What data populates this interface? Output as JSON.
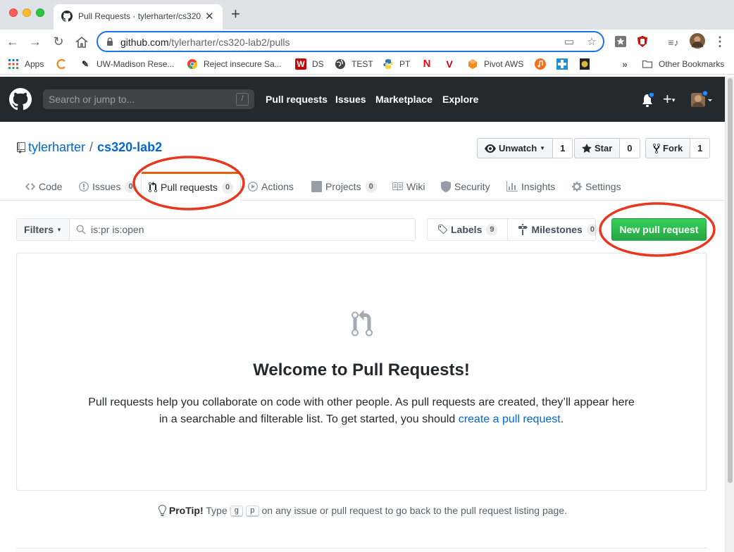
{
  "browser": {
    "tab_title": "Pull Requests · tylerharter/cs320",
    "new_tab": "+",
    "url_domain": "github.com",
    "url_path": "/tylerharter/cs320-lab2/pulls",
    "bookmarks": [
      {
        "label": "Apps",
        "icon": "apps-grid-icon"
      },
      {
        "label": "",
        "icon": "orange-c-icon"
      },
      {
        "label": "UW-Madison Rese...",
        "icon": "wand-icon"
      },
      {
        "label": "Reject insecure Sa...",
        "icon": "chrome-icon"
      },
      {
        "label": "DS",
        "icon": "w-icon"
      },
      {
        "label": "TEST",
        "icon": "globe-icon"
      },
      {
        "label": "PT",
        "icon": "python-icon"
      },
      {
        "label": "",
        "icon": "netflix-icon"
      },
      {
        "label": "",
        "icon": "v-icon"
      },
      {
        "label": "Pivot AWS",
        "icon": "hexagon-icon"
      }
    ],
    "overflow": "»",
    "other_bookmarks": "Other Bookmarks"
  },
  "gh_header": {
    "search_placeholder": "Search or jump to...",
    "search_key": "/",
    "nav": [
      "Pull requests",
      "Issues",
      "Marketplace",
      "Explore"
    ]
  },
  "repo": {
    "owner": "tylerharter",
    "separator": "/",
    "name": "cs320-lab2",
    "unwatch_label": "Unwatch",
    "unwatch_count": "1",
    "star_label": "Star",
    "star_count": "0",
    "fork_label": "Fork",
    "fork_count": "1"
  },
  "tabs": [
    {
      "label": "Code",
      "count": null
    },
    {
      "label": "Issues",
      "count": "0"
    },
    {
      "label": "Pull requests",
      "count": "0"
    },
    {
      "label": "Actions",
      "count": null
    },
    {
      "label": "Projects",
      "count": "0"
    },
    {
      "label": "Wiki",
      "count": null
    },
    {
      "label": "Security",
      "count": null
    },
    {
      "label": "Insights",
      "count": null
    },
    {
      "label": "Settings",
      "count": null
    }
  ],
  "subnav": {
    "filters_label": "Filters",
    "search_value": "is:pr is:open",
    "labels_label": "Labels",
    "labels_count": "9",
    "milestones_label": "Milestones",
    "milestones_count": "0",
    "new_pr_label": "New pull request"
  },
  "blankslate": {
    "title": "Welcome to Pull Requests!",
    "text_before": "Pull requests help you collaborate on code with other people. As pull requests are created, they’ll appear here in a searchable and filterable list. To get started, you should ",
    "link": "create a pull request",
    "text_after": "."
  },
  "protip": {
    "label": "ProTip!",
    "before": " Type ",
    "key1": "g",
    "key2": "p",
    "after": " on any issue or pull request to go back to the pull request listing page."
  },
  "colors": {
    "accent_blue": "#0366d6",
    "selected_tab_border": "#e36209",
    "new_pr_green": "#28a745",
    "annotation_red": "#e8371f",
    "header_dark": "#24292e"
  }
}
